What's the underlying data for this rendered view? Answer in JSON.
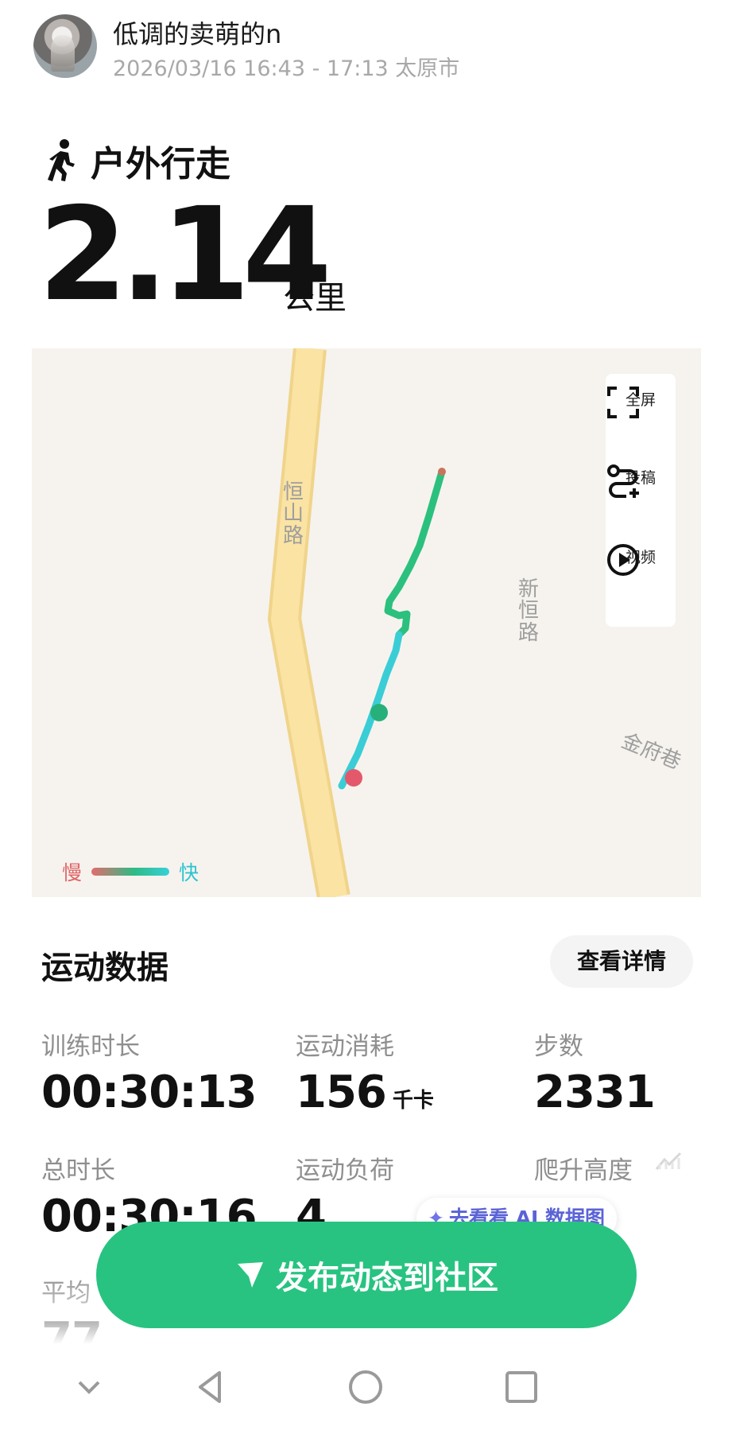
{
  "header": {
    "username": "低调的卖萌的n",
    "meta": "2026/03/16 16:43 - 17:13 太原市"
  },
  "activity": {
    "icon": "walking-person-icon",
    "type": "户外行走",
    "distance": "2.14",
    "distance_unit": "公里"
  },
  "map": {
    "roads": [
      "恒山路",
      "新恒路",
      "金府巷"
    ],
    "tools": [
      {
        "label": "全屏",
        "icon": "fullscreen-icon"
      },
      {
        "label": "投稿",
        "icon": "route-submit-icon"
      },
      {
        "label": "视频",
        "icon": "play-video-icon"
      }
    ],
    "legend": {
      "slow": "慢",
      "fast": "快"
    },
    "colors": {
      "route_slow": "#e46b6c",
      "route_mid": "#2dbb86",
      "route_fast": "#38d0d8",
      "road": "#f7de8e"
    }
  },
  "stats": {
    "title": "运动数据",
    "details_button": "查看详情",
    "items": [
      {
        "label": "训练时长",
        "value": "00:30:13",
        "unit": ""
      },
      {
        "label": "运动消耗",
        "value": "156",
        "unit": "千卡"
      },
      {
        "label": "步数",
        "value": "2331",
        "unit": ""
      },
      {
        "label": "总时长",
        "value": "00:30:16",
        "unit": ""
      },
      {
        "label": "运动负荷",
        "value": "4",
        "unit": ""
      },
      {
        "label": "爬升高度",
        "value": "",
        "unit": ""
      },
      {
        "label": "平均",
        "value": "77",
        "unit": ""
      }
    ]
  },
  "ai_chip": {
    "label": "去看看 AI 数据图"
  },
  "publish": {
    "label": "发布动态到社区",
    "color": "#28c381"
  },
  "navbar": {
    "icons": [
      "chevron-down-icon",
      "back-triangle-icon",
      "home-circle-icon",
      "recent-square-icon"
    ]
  }
}
